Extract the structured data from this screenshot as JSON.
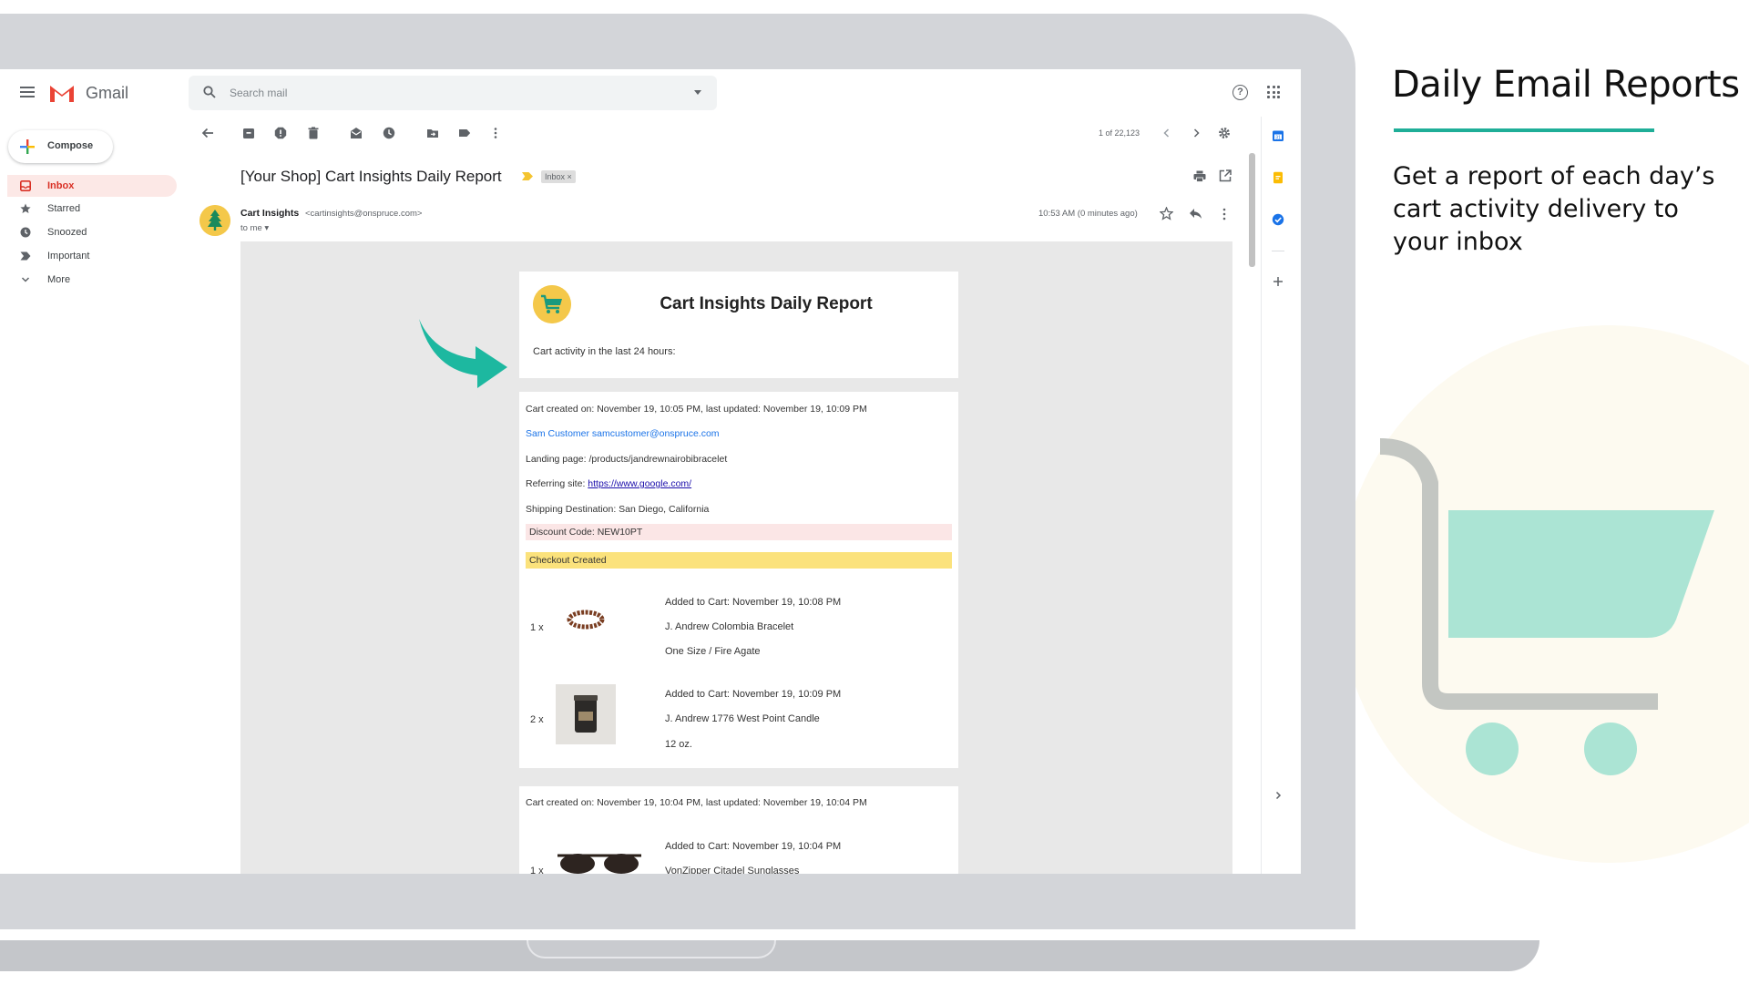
{
  "promo": {
    "title": "Daily Email Reports",
    "subtitle": "Get a report of each day’s cart activity delivery to your inbox",
    "accent_color": "#1fae98",
    "cart_color": "#abe4d4"
  },
  "gmail": {
    "app_name": "Gmail",
    "search_placeholder": "Search mail",
    "compose_label": "Compose",
    "nav": [
      {
        "label": "Inbox",
        "icon": "inbox-icon",
        "active": true
      },
      {
        "label": "Starred",
        "icon": "star-icon"
      },
      {
        "label": "Snoozed",
        "icon": "clock-icon"
      },
      {
        "label": "Important",
        "icon": "important-icon"
      },
      {
        "label": "More",
        "icon": "chevron-down-icon"
      }
    ],
    "toolbar": {
      "icons": [
        "back-arrow-icon",
        "archive-icon",
        "report-spam-icon",
        "delete-icon",
        "mark-unread-icon",
        "snooze-icon",
        "move-to-icon",
        "label-icon",
        "more-vert-icon"
      ],
      "pager": "1 of 22,123",
      "settings_icon": "gear-icon"
    },
    "email": {
      "subject": "[Your Shop] Cart Insights Daily Report",
      "label_chip": "Inbox ×",
      "sender_name": "Cart Insights",
      "sender_email": "<cartinsights@onspruce.com>",
      "to": "to me ▾",
      "timestamp": "10:53 AM (0 minutes ago)"
    }
  },
  "report": {
    "title": "Cart Insights Daily Report",
    "subtitle": "Cart activity in the last 24 hours:",
    "carts": [
      {
        "created": "Cart created on: November 19, 10:05 PM, last updated: November 19, 10:09 PM",
        "customer": "Sam Customer samcustomer@onspruce.com",
        "landing": "Landing page: /products/jandrewnairobibracelet",
        "referring_prefix": "Referring site: ",
        "referring_link": "https://www.google.com/",
        "shipping": "Shipping Destination: San Diego, California",
        "discount": "Discount Code: NEW10PT",
        "status": "Checkout Created",
        "items": [
          {
            "qty": "1 x",
            "added": "Added to Cart: November 19, 10:08 PM",
            "name": "J. Andrew Colombia Bracelet",
            "variant": "One Size / Fire Agate"
          },
          {
            "qty": "2 x",
            "added": "Added to Cart: November 19, 10:09 PM",
            "name": "J. Andrew 1776 West Point Candle",
            "variant": "12 oz."
          }
        ]
      },
      {
        "created": "Cart created on: November 19, 10:04 PM, last updated: November 19, 10:04 PM",
        "items": [
          {
            "qty": "1 x",
            "added": "Added to Cart: November 19, 10:04 PM",
            "name": "VonZipper Citadel Sunglasses"
          }
        ]
      }
    ]
  }
}
